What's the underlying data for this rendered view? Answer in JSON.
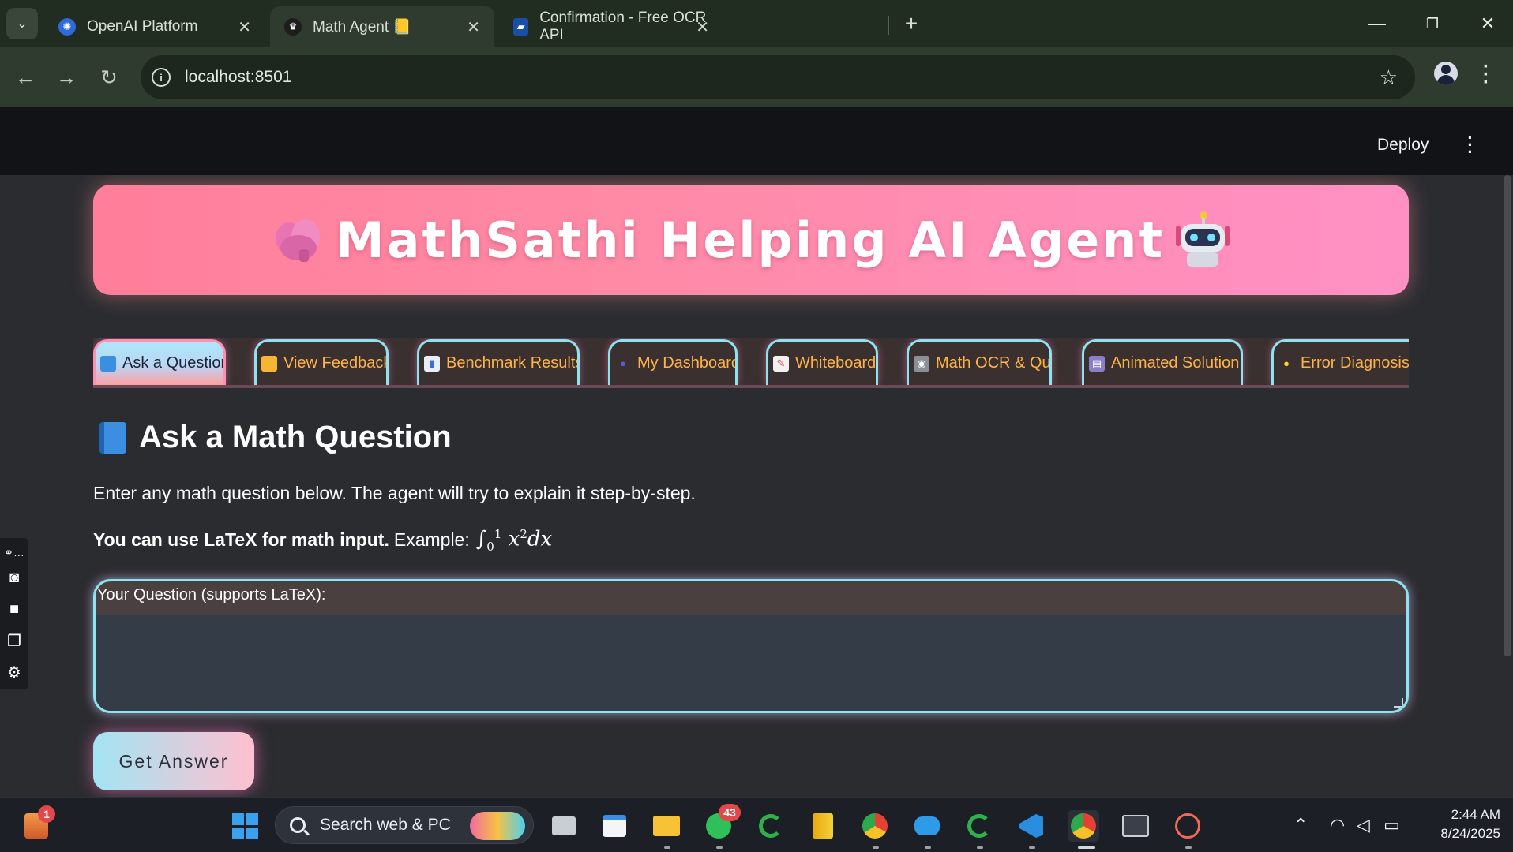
{
  "browser": {
    "tabs": [
      {
        "title": "OpenAI Platform",
        "active": false
      },
      {
        "title": "Math Agent 📒",
        "active": true
      },
      {
        "title": "Confirmation - Free OCR API",
        "active": false
      }
    ],
    "address": "localhost:8501"
  },
  "app": {
    "deploy_label": "Deploy",
    "banner_title": "MathSathi Helping AI Agent",
    "tabs": [
      {
        "label": "Ask a Question",
        "icon": "book-icon",
        "active": true
      },
      {
        "label": "View Feedback",
        "icon": "folder-icon",
        "active": false
      },
      {
        "label": "Benchmark Results",
        "icon": "chart-icon",
        "active": false
      },
      {
        "label": "My Dashboard",
        "icon": "person-icon",
        "active": false
      },
      {
        "label": "Whiteboard",
        "icon": "memo-icon",
        "active": false
      },
      {
        "label": "Math OCR & Quiz",
        "icon": "camera-icon",
        "active": false
      },
      {
        "label": "Animated Solution",
        "icon": "clapper-icon",
        "active": false
      },
      {
        "label": "Error Diagnosis",
        "icon": "bulb-icon",
        "active": false
      }
    ],
    "section_title": "Ask a Math Question",
    "description": "Enter any math question below. The agent will try to explain it step-by-step.",
    "latex_bold": "You can use LaTeX for math input.",
    "latex_example_label": "Example:",
    "question_label": "Your Question (supports LaTeX):",
    "question_value": "",
    "submit_label": "Get Answer"
  },
  "taskbar": {
    "search_text": "Search web & PC",
    "notification_badge": "1",
    "whatsapp_badge": "43",
    "time": "2:44 AM",
    "date": "8/24/2025"
  },
  "colors": {
    "banner_start": "#ff7e9a",
    "banner_end": "#ff90c4",
    "tab_border": "#8fe3f0",
    "tab_text": "#ffb347"
  }
}
